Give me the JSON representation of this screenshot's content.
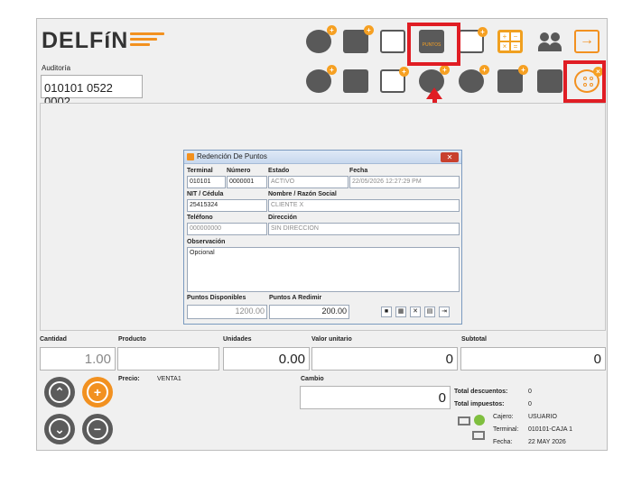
{
  "brand": {
    "name": "DELFíN"
  },
  "auditoria": {
    "label": "Auditoría",
    "value": "010101 0522 0002"
  },
  "toolbar": {
    "puntos_label": "PUNTOS"
  },
  "dialog": {
    "title": "Redención De Puntos",
    "close": "✕",
    "labels": {
      "terminal": "Terminal",
      "numero": "Número",
      "estado": "Estado",
      "fecha": "Fecha",
      "nit": "NIT / Cédula",
      "nombre": "Nombre / Razón Social",
      "telefono": "Teléfono",
      "direccion": "Dirección",
      "observacion": "Observación",
      "puntos_disponibles": "Puntos Disponibles",
      "puntos_redimir": "Puntos A Redimir"
    },
    "values": {
      "terminal": "010101",
      "numero": "0000001",
      "estado": "ACTIVO",
      "fecha": "22/05/2026 12:27:29 PM",
      "nit": "25415324",
      "nombre": "CLIENTE X",
      "telefono": "000000000",
      "direccion": "SIN DIRECCION",
      "observacion": "Opcional",
      "puntos_disponibles": "1200.00",
      "puntos_redimir": "200.00"
    }
  },
  "sale": {
    "cantidad_label": "Cantidad",
    "cantidad": "1.00",
    "producto_label": "Producto",
    "producto": "",
    "unidades_label": "Unidades",
    "unidades": "0.00",
    "valor_label": "Valor unitario",
    "valor": "0",
    "subtotal_label": "Subtotal",
    "subtotal": "0",
    "precio_label": "Precio:",
    "precio": "VENTA1",
    "cambio_label": "Cambio",
    "cambio": "0",
    "descuentos_label": "Total descuentos:",
    "descuentos": "0",
    "impuestos_label": "Total impuestos:",
    "impuestos": "0"
  },
  "session": {
    "cajero_label": "Cajero:",
    "cajero": "USUARIO",
    "terminal_label": "Terminal:",
    "terminal": "010101-CAJA 1",
    "fecha_label": "Fecha:",
    "fecha": "22 MAY 2026"
  },
  "colors": {
    "accent": "#f29120",
    "highlight": "#e01d24",
    "icon_dark": "#595959"
  }
}
